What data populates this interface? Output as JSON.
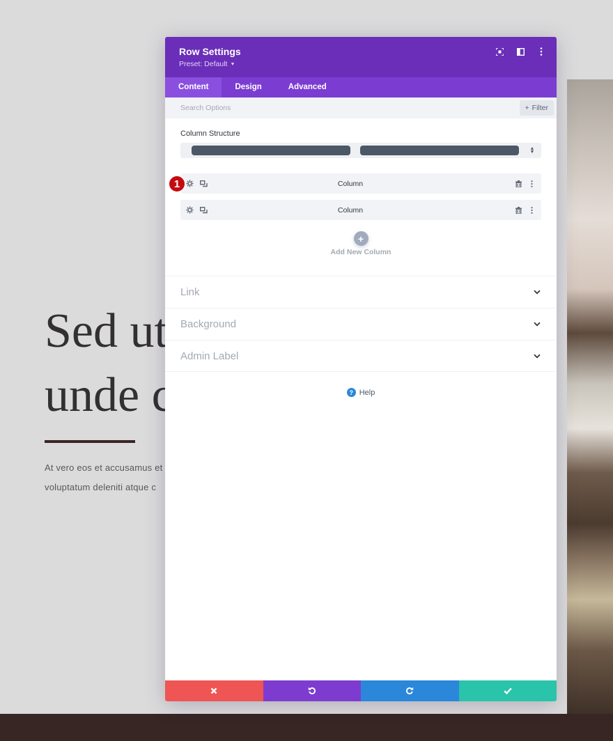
{
  "background_page": {
    "hero_title_lines": [
      "Sed ut",
      "unde c"
    ],
    "hero_text_lines": [
      "At vero eos et accusamus et",
      "voluptatum deleniti atque c"
    ]
  },
  "modal": {
    "title": "Row Settings",
    "preset": "Preset: Default",
    "header_icons": [
      "focus-icon",
      "split-view-icon",
      "more-options-icon"
    ],
    "tabs": [
      {
        "label": "Content",
        "active": true
      },
      {
        "label": "Design",
        "active": false
      },
      {
        "label": "Advanced",
        "active": false
      }
    ],
    "search": {
      "placeholder": "Search Options",
      "value": ""
    },
    "filter_label": "Filter",
    "column_structure": {
      "label": "Column Structure",
      "selected": "1/2 + 1/2"
    },
    "columns": [
      {
        "label": "Column",
        "badge": "1"
      },
      {
        "label": "Column"
      }
    ],
    "add_column_label": "Add New Column",
    "sections": [
      {
        "title": "Link"
      },
      {
        "title": "Background"
      },
      {
        "title": "Admin Label"
      }
    ],
    "help_label": "Help",
    "actions": {
      "discard": "discard",
      "undo": "undo",
      "redo": "redo",
      "save": "save"
    }
  },
  "colors": {
    "header": "#6a2eb8",
    "tabs": "#7b3cd1",
    "discard": "#ef5555",
    "undo": "#7e3bd0",
    "redo": "#2b87da",
    "save": "#29c4a9",
    "badge": "#c40b12"
  }
}
